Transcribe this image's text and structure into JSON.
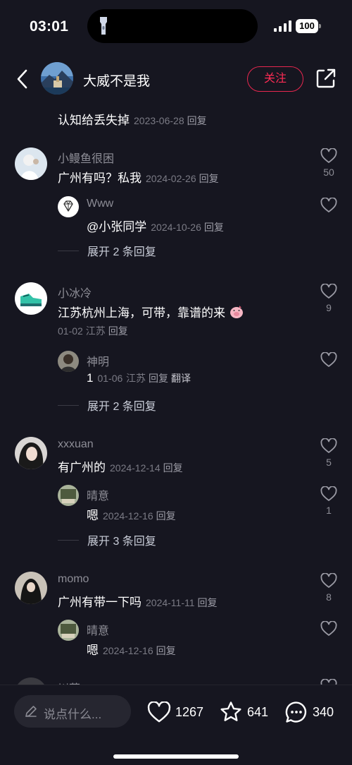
{
  "status_bar": {
    "time": "03:01",
    "battery": "100"
  },
  "header": {
    "name": "大威不是我",
    "follow_label": "关注"
  },
  "reply_label": "回复",
  "translate_label": "翻译",
  "thread": [
    {
      "content": "认知给丢失掉",
      "date": "2023-06-28"
    },
    {
      "username": "小鳗鱼很困",
      "content": "广州有吗？私我",
      "date": "2024-02-26",
      "likes": "50"
    },
    {
      "username": "Www",
      "content": "@小张同学",
      "date": "2024-10-26"
    },
    {
      "expand": "展开 2 条回复"
    },
    {
      "username": "小冰冷",
      "content": "江苏杭州上海，可带，靠谱的来",
      "date": "01-02",
      "location": "江苏",
      "likes": "9"
    },
    {
      "username": "神明",
      "content": "1",
      "date": "01-06",
      "location": "江苏"
    },
    {
      "expand": "展开 2 条回复"
    },
    {
      "username": "xxxuan",
      "content": "有广州的",
      "date": "2024-12-14",
      "likes": "5"
    },
    {
      "username": "晴意",
      "content": "嗯",
      "date": "2024-12-16",
      "likes": "1"
    },
    {
      "expand": "展开 3 条回复"
    },
    {
      "username": "momo",
      "content": "广州有带一下吗",
      "date": "2024-11-11",
      "likes": "8"
    },
    {
      "username": "晴意",
      "content": "嗯",
      "date": "2024-12-16"
    },
    {
      "username": "川菇"
    }
  ],
  "bottom_bar": {
    "input_placeholder": "说点什么...",
    "likes": "1267",
    "favorites": "641",
    "comments": "340"
  },
  "colors": {
    "background": "#161620",
    "accent": "#ff2c55",
    "muted_text": "#8d8d96"
  }
}
